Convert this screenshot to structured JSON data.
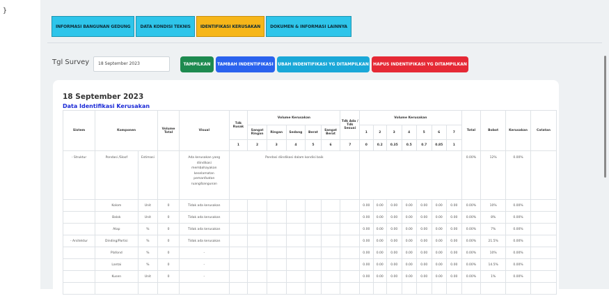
{
  "brace": "}",
  "tabs": [
    "INFORMASI BANGUNAN GEDUNG",
    "DATA KONDISI TEKNIS",
    "IDENTIFIKASI KERUSAKAN",
    "DOKUMEN & INFORMASI LAINNYA"
  ],
  "active_tab": "IDENTIFIKASI KERUSAKAN",
  "survey": {
    "label": "Tgl Survey",
    "value": "18 September 2023"
  },
  "buttons": {
    "tampilkan": "TAMPILKAN",
    "tambah": "TAMBAH INDENTIFIKASI",
    "ubah": "UBAH INDENTIFIKASI YG DITAMPILKAN",
    "hapus": "HAPUS INDENTIFIKASI YG DITAMPILKAN"
  },
  "colors": {
    "tab": "#2ec5ea",
    "tab_active": "#f6b619",
    "tampilkan": "#1d8a4f",
    "tambah": "#2a62ee",
    "ubah": "#1aa8d8",
    "hapus": "#e52935",
    "subheading": "#1a29d6"
  },
  "card": {
    "date": "18 September 2023",
    "title": "Data Identifikasi Kerusakan"
  },
  "table": {
    "headers": {
      "sistem": "Sistem",
      "komponen": "Komponen",
      "volume_total": "Volume Total",
      "visual": "Visual",
      "tdk_rusak": "Tdk Rusak",
      "volume_kerusakan": "Volume Kerusakan",
      "sangat_ringan": "Sangat Ringan",
      "ringan": "Ringan",
      "sedang": "Sedang",
      "berat": "Berat",
      "sangat_berat": "Sangat Berat",
      "tdk_ada": "Tdk Ada / Tdk Sesuai",
      "volume_kerusakan_2": "Volume Kerusakan",
      "total": "Total",
      "bobot": "Bobot",
      "kerusakan": "Kerusakan",
      "catatan": "Catatan"
    },
    "weights": [
      "1",
      "2",
      "3",
      "4",
      "5",
      "6",
      "7"
    ],
    "numbers_a": [
      "1",
      "2",
      "3",
      "4",
      "5",
      "6",
      "7"
    ],
    "numbers_b": [
      "0",
      "0.2",
      "0.35",
      "0.5",
      "0.7",
      "0.85",
      "1"
    ],
    "first_row": {
      "sistem": "- Struktur",
      "komponen": "Pondasi /Sloof",
      "unit": "Estimasi",
      "visual": "Ada kerusakan yang diindikasi membahayakan keselamatan pemanfaatan ruang/bangunan",
      "note": "Pondasi diindikasi dalam kondisi baik",
      "total": "0.00%",
      "bobot": "12%",
      "kerusakan": "0.00%"
    },
    "rows": [
      {
        "sistem": "",
        "komponen": "Kolom",
        "unit": "Unit",
        "vol": "0",
        "visual": "Tidak ada kerusakan",
        "vals": [
          "0.00",
          "0.00",
          "0.00",
          "0.00",
          "0.00",
          "0.00",
          "0.00"
        ],
        "total": "0.00%",
        "bobot": "10%",
        "kerusakan": "0.00%"
      },
      {
        "sistem": "",
        "komponen": "Balok",
        "unit": "Unit",
        "vol": "0",
        "visual": "Tidak ada kerusakan",
        "vals": [
          "0.00",
          "0.00",
          "0.00",
          "0.00",
          "0.00",
          "0.00",
          "0.00"
        ],
        "total": "0.00%",
        "bobot": "8%",
        "kerusakan": "0.00%"
      },
      {
        "sistem": "",
        "komponen": "Atap",
        "unit": "%",
        "vol": "0",
        "visual": "Tidak ada kerusakan",
        "vals": [
          "0.00",
          "0.00",
          "0.00",
          "0.00",
          "0.00",
          "0.00",
          "0.00"
        ],
        "total": "0.00%",
        "bobot": "7%",
        "kerusakan": "0.00%"
      },
      {
        "sistem": "- Arsitektur",
        "komponen": "Dinding/Partisi",
        "unit": "%",
        "vol": "0",
        "visual": "Tidak ada kerusakan",
        "vals": [
          "0.00",
          "0.00",
          "0.00",
          "0.00",
          "0.00",
          "0.00",
          "0.00"
        ],
        "total": "0.00%",
        "bobot": "21.5%",
        "kerusakan": "0.00%"
      },
      {
        "sistem": "",
        "komponen": "Plafond",
        "unit": "%",
        "vol": "0",
        "visual": "-",
        "vals": [
          "0.00",
          "0.00",
          "0.00",
          "0.00",
          "0.00",
          "0.00",
          "0.00"
        ],
        "total": "0.00%",
        "bobot": "10%",
        "kerusakan": "0.00%"
      },
      {
        "sistem": "",
        "komponen": "Lantai",
        "unit": "%",
        "vol": "0",
        "visual": "-",
        "vals": [
          "0.00",
          "0.00",
          "0.00",
          "0.00",
          "0.00",
          "0.00",
          "0.00"
        ],
        "total": "0.00%",
        "bobot": "14.5%",
        "kerusakan": "0.00%"
      },
      {
        "sistem": "",
        "komponen": "Kusen",
        "unit": "Unit",
        "vol": "0",
        "visual": "-",
        "vals": [
          "0.00",
          "0.00",
          "0.00",
          "0.00",
          "0.00",
          "0.00",
          "0.00"
        ],
        "total": "0.00%",
        "bobot": "1%",
        "kerusakan": "0.00%"
      },
      {
        "sistem": "",
        "komponen": "",
        "unit": "",
        "vol": "",
        "visual": "",
        "vals": [
          "",
          "",
          "",
          "",
          "",
          "",
          ""
        ],
        "total": "",
        "bobot": "",
        "kerusakan": ""
      }
    ]
  }
}
